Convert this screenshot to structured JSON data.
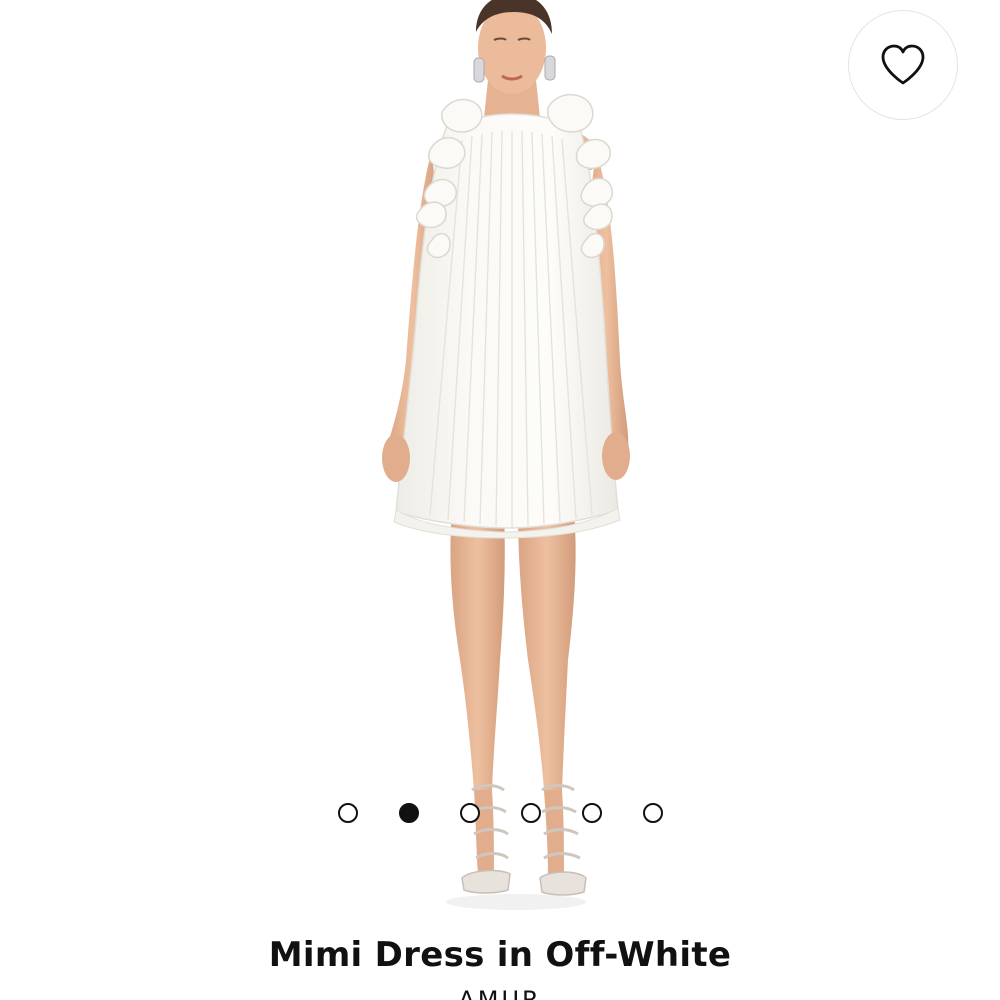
{
  "product": {
    "title": "Mimi Dress in Off-White",
    "brand": "AMUR"
  },
  "carousel": {
    "total_images": 6,
    "active_index": 1
  },
  "icons": {
    "favorite": "heart-outline-icon"
  },
  "colors": {
    "text": "#111111",
    "background": "#ffffff",
    "dress": "#f8f7f2"
  }
}
